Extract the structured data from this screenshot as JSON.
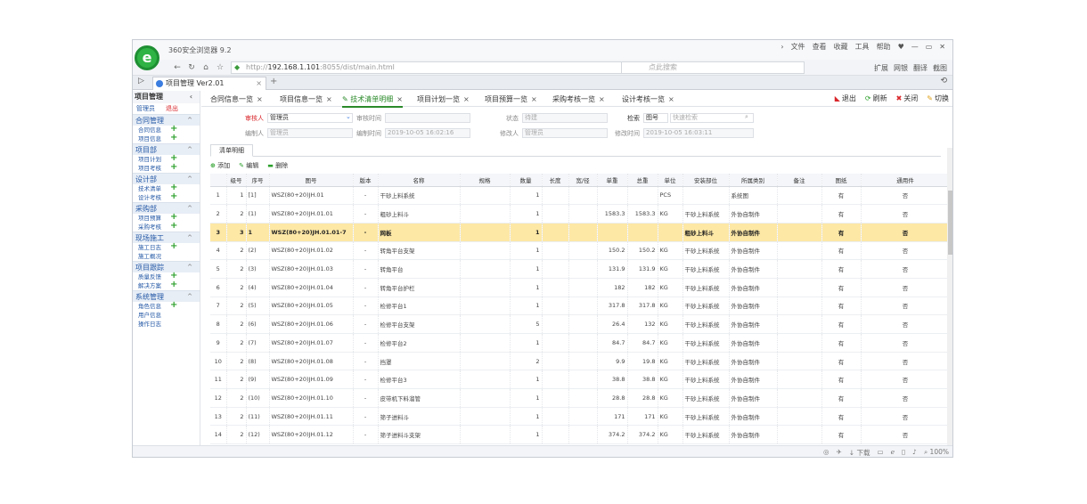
{
  "browser": {
    "title": "360安全浏览器 9.2",
    "menu": [
      "文件",
      "查看",
      "收藏",
      "工具",
      "帮助"
    ],
    "url_prefix": "http://",
    "url_host": "192.168.1.101",
    "url_rest": ":8055/dist/main.html",
    "search_placeholder": "点此搜索",
    "tools": [
      "扩展",
      "网银",
      "翻译",
      "截图"
    ],
    "tab_title": "项目管理 Ver2.01",
    "status_tools": [
      "下载",
      "100%"
    ]
  },
  "sidebar": {
    "header": "项目管理",
    "user": "管理员",
    "logout": "退出",
    "groups": [
      {
        "label": "合同管理",
        "items": [
          {
            "label": "合同信息",
            "add": true
          },
          {
            "label": "项目信息",
            "add": true
          }
        ]
      },
      {
        "label": "项目部",
        "items": [
          {
            "label": "项目计划",
            "add": true
          },
          {
            "label": "项目考核",
            "add": true
          }
        ]
      },
      {
        "label": "设计部",
        "items": [
          {
            "label": "技术清单",
            "add": true
          },
          {
            "label": "设计考核",
            "add": true
          }
        ]
      },
      {
        "label": "采购部",
        "items": [
          {
            "label": "项目预算",
            "add": true
          },
          {
            "label": "采购考核",
            "add": true
          }
        ]
      },
      {
        "label": "现场施工",
        "items": [
          {
            "label": "施工日志",
            "add": true
          },
          {
            "label": "施工概况",
            "add": false
          }
        ]
      },
      {
        "label": "项目跟踪",
        "items": [
          {
            "label": "质量反馈",
            "add": true
          },
          {
            "label": "解决方案",
            "add": true
          }
        ]
      },
      {
        "label": "系统管理",
        "items": [
          {
            "label": "角色信息",
            "add": true
          },
          {
            "label": "用户信息",
            "add": false
          },
          {
            "label": "操作日志",
            "add": false
          }
        ]
      }
    ]
  },
  "tabs": [
    {
      "label": "合同信息一览",
      "active": false
    },
    {
      "label": "项目信息一览",
      "active": false
    },
    {
      "label": "技术清单明细",
      "active": true
    },
    {
      "label": "项目计划一览",
      "active": false
    },
    {
      "label": "项目预算一览",
      "active": false
    },
    {
      "label": "采购考核一览",
      "active": false
    },
    {
      "label": "设计考核一览",
      "active": false
    }
  ],
  "actions": {
    "exit": "退出",
    "refresh": "刷新",
    "close": "关闭",
    "switch": "切换"
  },
  "form": {
    "reviewer_label": "审核人",
    "reviewer": "管理员",
    "review_time_label": "审核时间",
    "review_time": "",
    "status_label": "状态",
    "status": "待建",
    "search_label": "检索",
    "search_field": "图号",
    "search_placeholder": "快速检索",
    "editor_label": "编制人",
    "editor": "管理员",
    "edit_time_label": "编制时间",
    "edit_time": "2019-10-05 16:02:16",
    "modifier_label": "修改人",
    "modifier": "管理员",
    "modify_time_label": "修改时间",
    "modify_time": "2019-10-05 16:03:11"
  },
  "inner_tab": "清单明细",
  "toolbar": {
    "add": "添加",
    "edit": "编辑",
    "delete": "删除"
  },
  "columns": [
    "",
    "级号",
    "序号",
    "图号",
    "版本",
    "名称",
    "规格",
    "数量",
    "长度",
    "宽/径",
    "单重",
    "总重",
    "单位",
    "安装部位",
    "所属类别",
    "备注",
    "图纸",
    "通用件"
  ],
  "rows": [
    {
      "n": "1",
      "lv": "1",
      "seq": "[1]",
      "dwg": "WSZ(80+20)JH.01",
      "ver": "-",
      "name": "干砂上料系统",
      "qty": "1",
      "uw": "",
      "tw": "",
      "unit": "PCS",
      "pos": "",
      "cat": "系统图",
      "draw": "有",
      "common": "否",
      "sel": false
    },
    {
      "n": "2",
      "lv": "2",
      "seq": "(1)",
      "dwg": "WSZ(80+20)JH.01.01",
      "ver": "-",
      "name": "粗砂上料斗",
      "qty": "1",
      "uw": "1583.3",
      "tw": "1583.3",
      "unit": "KG",
      "pos": "干砂上料系统",
      "cat": "外协自制件",
      "draw": "有",
      "common": "否",
      "sel": false
    },
    {
      "n": "3",
      "lv": "3",
      "seq": "1",
      "dwg": "WSZ(80+20)JH.01.01-7",
      "ver": "-",
      "name": "网板",
      "qty": "1",
      "uw": "",
      "tw": "",
      "unit": "",
      "pos": "粗砂上料斗",
      "cat": "外协自制件",
      "draw": "有",
      "common": "否",
      "sel": true
    },
    {
      "n": "4",
      "lv": "2",
      "seq": "(2)",
      "dwg": "WSZ(80+20)JH.01.02",
      "ver": "-",
      "name": "转角平台支架",
      "qty": "1",
      "uw": "150.2",
      "tw": "150.2",
      "unit": "KG",
      "pos": "干砂上料系统",
      "cat": "外协自制件",
      "draw": "有",
      "common": "否",
      "sel": false
    },
    {
      "n": "5",
      "lv": "2",
      "seq": "(3)",
      "dwg": "WSZ(80+20)JH.01.03",
      "ver": "-",
      "name": "转角平台",
      "qty": "1",
      "uw": "131.9",
      "tw": "131.9",
      "unit": "KG",
      "pos": "干砂上料系统",
      "cat": "外协自制件",
      "draw": "有",
      "common": "否",
      "sel": false
    },
    {
      "n": "6",
      "lv": "2",
      "seq": "(4)",
      "dwg": "WSZ(80+20)JH.01.04",
      "ver": "-",
      "name": "转角平台护栏",
      "qty": "1",
      "uw": "182",
      "tw": "182",
      "unit": "KG",
      "pos": "干砂上料系统",
      "cat": "外协自制件",
      "draw": "有",
      "common": "否",
      "sel": false
    },
    {
      "n": "7",
      "lv": "2",
      "seq": "(5)",
      "dwg": "WSZ(80+20)JH.01.05",
      "ver": "-",
      "name": "检修平台1",
      "qty": "1",
      "uw": "317.8",
      "tw": "317.8",
      "unit": "KG",
      "pos": "干砂上料系统",
      "cat": "外协自制件",
      "draw": "有",
      "common": "否",
      "sel": false
    },
    {
      "n": "8",
      "lv": "2",
      "seq": "(6)",
      "dwg": "WSZ(80+20)JH.01.06",
      "ver": "-",
      "name": "检修平台支架",
      "qty": "5",
      "uw": "26.4",
      "tw": "132",
      "unit": "KG",
      "pos": "干砂上料系统",
      "cat": "外协自制件",
      "draw": "有",
      "common": "否",
      "sel": false
    },
    {
      "n": "9",
      "lv": "2",
      "seq": "(7)",
      "dwg": "WSZ(80+20)JH.01.07",
      "ver": "-",
      "name": "检修平台2",
      "qty": "1",
      "uw": "84.7",
      "tw": "84.7",
      "unit": "KG",
      "pos": "干砂上料系统",
      "cat": "外协自制件",
      "draw": "有",
      "common": "否",
      "sel": false
    },
    {
      "n": "10",
      "lv": "2",
      "seq": "(8)",
      "dwg": "WSZ(80+20)JH.01.08",
      "ver": "-",
      "name": "挡罩",
      "qty": "2",
      "uw": "9.9",
      "tw": "19.8",
      "unit": "KG",
      "pos": "干砂上料系统",
      "cat": "外协自制件",
      "draw": "有",
      "common": "否",
      "sel": false
    },
    {
      "n": "11",
      "lv": "2",
      "seq": "(9)",
      "dwg": "WSZ(80+20)JH.01.09",
      "ver": "-",
      "name": "检修平台3",
      "qty": "1",
      "uw": "38.8",
      "tw": "38.8",
      "unit": "KG",
      "pos": "干砂上料系统",
      "cat": "外协自制件",
      "draw": "有",
      "common": "否",
      "sel": false
    },
    {
      "n": "12",
      "lv": "2",
      "seq": "(10)",
      "dwg": "WSZ(80+20)JH.01.10",
      "ver": "-",
      "name": "皮带机下料溜管",
      "qty": "1",
      "uw": "28.8",
      "tw": "28.8",
      "unit": "KG",
      "pos": "干砂上料系统",
      "cat": "外协自制件",
      "draw": "有",
      "common": "否",
      "sel": false
    },
    {
      "n": "13",
      "lv": "2",
      "seq": "(11)",
      "dwg": "WSZ(80+20)JH.01.11",
      "ver": "-",
      "name": "筛子进料斗",
      "qty": "1",
      "uw": "171",
      "tw": "171",
      "unit": "KG",
      "pos": "干砂上料系统",
      "cat": "外协自制件",
      "draw": "有",
      "common": "否",
      "sel": false
    },
    {
      "n": "14",
      "lv": "2",
      "seq": "(12)",
      "dwg": "WSZ(80+20)JH.01.12",
      "ver": "-",
      "name": "筛子进料斗支架",
      "qty": "1",
      "uw": "374.2",
      "tw": "374.2",
      "unit": "KG",
      "pos": "干砂上料系统",
      "cat": "外协自制件",
      "draw": "有",
      "common": "否",
      "sel": false
    }
  ]
}
